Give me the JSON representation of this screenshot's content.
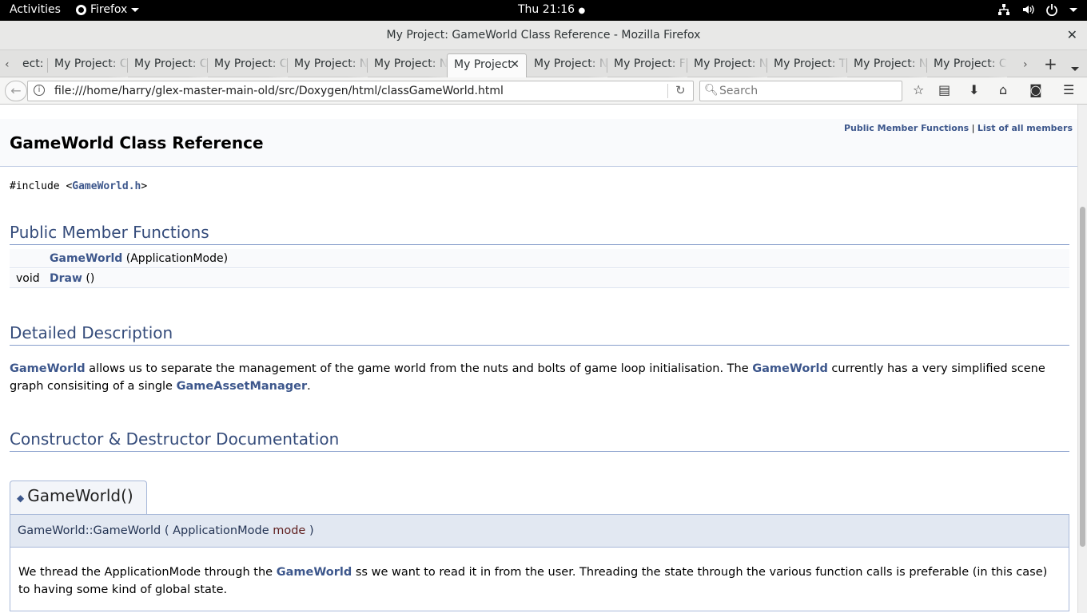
{
  "topbar": {
    "activities": "Activities",
    "app_name": "Firefox",
    "clock": "Thu 21:16"
  },
  "window": {
    "title": "My Project: GameWorld Class Reference - Mozilla Firefox",
    "close": "✕"
  },
  "tabs": [
    {
      "label": "ect: M"
    },
    {
      "label": "My Project: C"
    },
    {
      "label": "My Project: C"
    },
    {
      "label": "My Project: C"
    },
    {
      "label": "My Project: N"
    },
    {
      "label": "My Project: N"
    },
    {
      "label": "My Project",
      "active": true
    },
    {
      "label": "My Project: N"
    },
    {
      "label": "My Project: F"
    },
    {
      "label": "My Project: N"
    },
    {
      "label": "My Project: T"
    },
    {
      "label": "My Project: N"
    },
    {
      "label": "My Project: C"
    }
  ],
  "navbar": {
    "url": "file:///home/harry/glex-master-main-old/src/Doxygen/html/classGameWorld.html",
    "search_placeholder": "Search"
  },
  "page": {
    "summary_public": "Public Member Functions",
    "summary_sep": "|",
    "summary_all": "List of all members",
    "title": "GameWorld Class Reference",
    "include_prefix": "#include <",
    "include_file": "GameWorld.h",
    "include_suffix": ">",
    "public_header": "Public Member Functions",
    "members": [
      {
        "type": "",
        "name": "GameWorld",
        "args": " (ApplicationMode)"
      },
      {
        "type": "void",
        "name": "Draw",
        "args": " ()"
      }
    ],
    "detailed_header": "Detailed Description",
    "desc_link1": "GameWorld",
    "desc_text1": " allows us to separate the management of the game world from the nuts and bolts of game loop initialisation. The ",
    "desc_link2": "GameWorld",
    "desc_text2": " currently has a very simplified scene graph consisiting of a single ",
    "desc_link3": "GameAssetManager",
    "desc_text3": ".",
    "ctor_header": "Constructor & Destructor Documentation",
    "memtitle": "GameWorld()",
    "proto_prefix": "GameWorld::GameWorld ( ApplicationMode ",
    "proto_param": "mode",
    "proto_suffix": " )",
    "doc_text1": "We thread the ApplicationMode through the ",
    "doc_link": "GameWorld",
    "doc_text2": " ss we want to read it in from the user. Threading the state through the various function calls is preferable (in this case) to having some kind of global state."
  }
}
